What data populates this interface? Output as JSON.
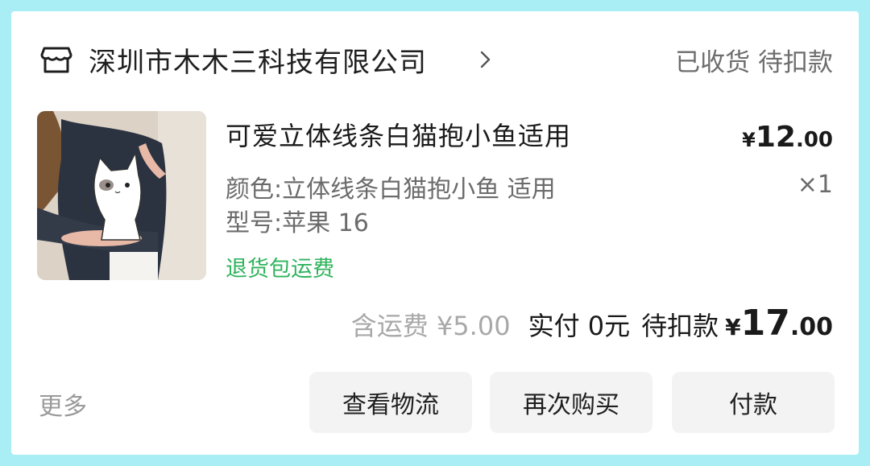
{
  "store": {
    "name": "深圳市木木三科技有限公司",
    "icon": "store-icon",
    "chevron_icon": "chevron-right-icon"
  },
  "order": {
    "status": "已收货 待扣款"
  },
  "product": {
    "title": "可爱立体线条白猫抱小鱼适用",
    "price_symbol": "¥",
    "price_int": "12",
    "price_dec": ".00",
    "spec_color": "颜色:立体线条白猫抱小鱼 适用",
    "spec_model": "型号:苹果 16",
    "quantity": "×1",
    "return_tag": "退货包运费",
    "thumbnail": "product-photo-white-cat-phone-case"
  },
  "summary": {
    "shipping": "含运费 ¥5.00",
    "paid": "实付 0元",
    "pending": "待扣款",
    "total_symbol": "¥",
    "total_int": "17",
    "total_dec": ".00"
  },
  "actions": {
    "more": "更多",
    "logistics": "查看物流",
    "rebuy": "再次购买",
    "pay": "付款"
  },
  "colors": {
    "page_bg": "#a9eef4",
    "card_bg": "#ffffff",
    "return_tag": "#2fb35c",
    "button_bg": "#f3f3f3"
  }
}
